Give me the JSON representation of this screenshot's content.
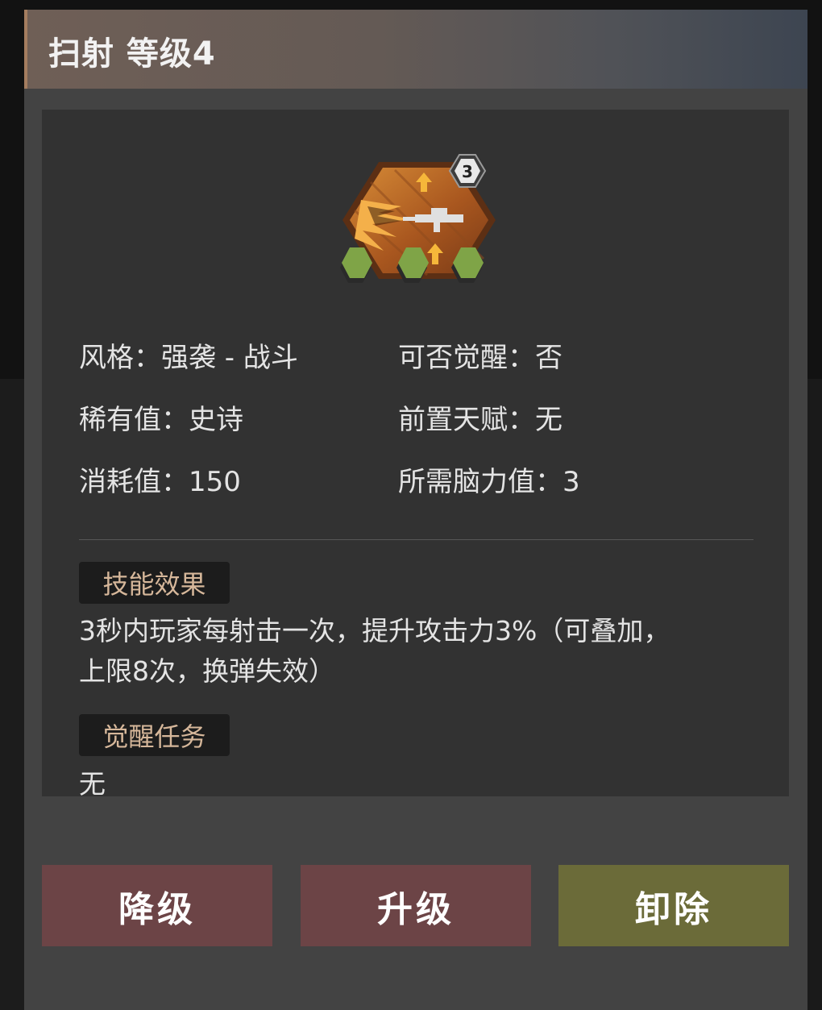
{
  "dialog": {
    "title": "扫射 等级4"
  },
  "skill": {
    "icon": "strafe-skill-icon",
    "badge_level": "3",
    "accent_color": "#c47a2c",
    "slot_color": "#7fa447"
  },
  "info": {
    "style": "风格：强袭 - 战斗",
    "awakenable": "可否觉醒：否",
    "rarity": "稀有值：史诗",
    "prerequisite": "前置天赋：无",
    "cost": "消耗值：150",
    "brainpower": "所需脑力值：3"
  },
  "sections": {
    "effect_title": "技能效果",
    "effect_line1": "3秒内玩家每射击一次，提升攻击力3%（可叠加，",
    "effect_line2": "上限8次，换弹失效）",
    "awaken_title": "觉醒任务",
    "awaken_body": "无"
  },
  "buttons": {
    "downgrade": "降级",
    "upgrade": "升级",
    "remove": "卸除",
    "downgrade_color": "#6c4446",
    "upgrade_color": "#6c4446",
    "remove_color": "#6b6b39"
  }
}
